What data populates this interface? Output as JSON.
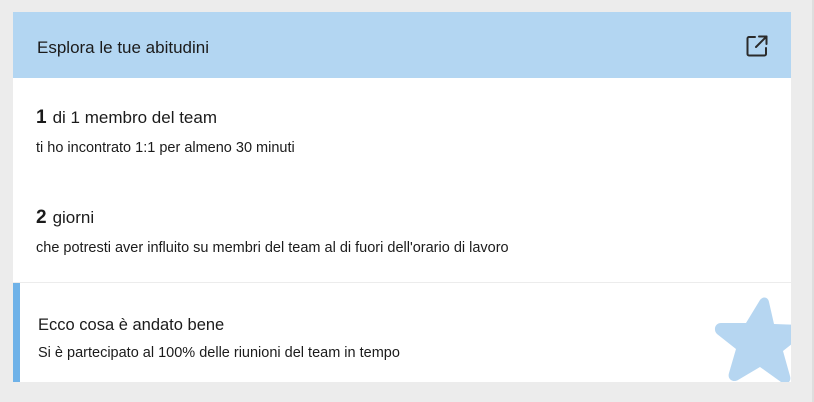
{
  "card": {
    "title": "Esplora le tue abitudini",
    "open_icon": "open-in-new-icon",
    "header_color": "#b3d6f2"
  },
  "stats": [
    {
      "number": "1",
      "label": "di 1 membro del team",
      "description": "ti ho incontrato 1:1 per almeno 30 minuti"
    },
    {
      "number": "2",
      "label": "giorni",
      "description": "che potresti aver influito su membri del team al di fuori dell'orario di lavoro"
    }
  ],
  "highlight": {
    "title": "Ecco cosa è andato bene",
    "description": "Si è partecipato al 100% delle riunioni del team in tempo",
    "icon": "star-icon",
    "accent_color": "#6fb2e8"
  }
}
